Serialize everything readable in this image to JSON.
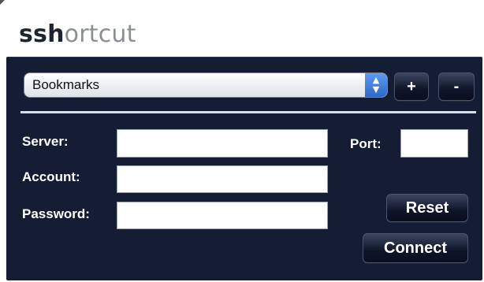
{
  "app": {
    "title_bold": "ssh",
    "title_rest": "ortcut"
  },
  "bookmarks": {
    "selected": "Bookmarks",
    "stepper_icon": "up-down-arrows-icon",
    "add_label": "+",
    "remove_label": "-"
  },
  "form": {
    "server_label": "Server:",
    "server_value": "",
    "account_label": "Account:",
    "account_value": "",
    "password_label": "Password:",
    "password_value": "",
    "port_label": "Port:",
    "port_value": ""
  },
  "actions": {
    "reset_label": "Reset",
    "connect_label": "Connect"
  },
  "colors": {
    "panel": "#141d33",
    "accent": "#2d68c9"
  }
}
